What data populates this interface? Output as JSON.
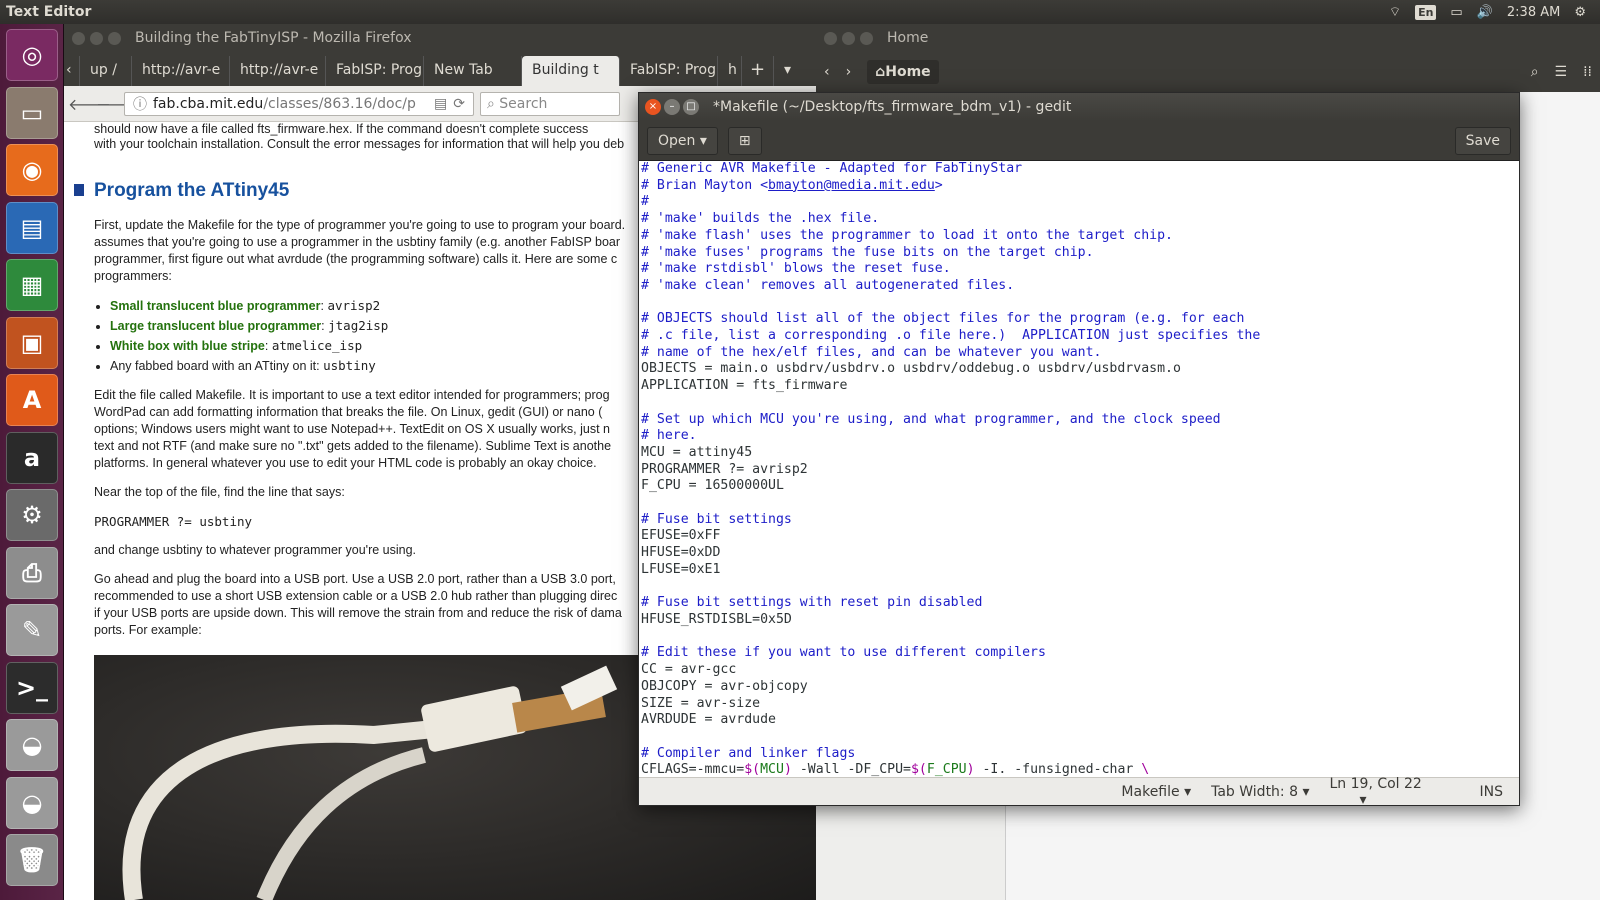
{
  "topbar": {
    "app": "Text Editor",
    "lang": "En",
    "time": "2:38 AM"
  },
  "launcher": [
    {
      "name": "ubuntu-dash-icon",
      "glyph": "◎",
      "color": "#7a2a62"
    },
    {
      "name": "files-icon",
      "glyph": "▭",
      "color": "#8a7b6e"
    },
    {
      "name": "firefox-icon",
      "glyph": "◉",
      "color": "#e76b1c"
    },
    {
      "name": "writer-icon",
      "glyph": "▤",
      "color": "#2a69b5"
    },
    {
      "name": "calc-icon",
      "glyph": "▦",
      "color": "#2e8a3c"
    },
    {
      "name": "impress-icon",
      "glyph": "▣",
      "color": "#c1531f"
    },
    {
      "name": "software-center-icon",
      "glyph": "A",
      "color": "#e05a1a"
    },
    {
      "name": "amazon-icon",
      "glyph": "a",
      "color": "#2a2a2a"
    },
    {
      "name": "system-settings-icon",
      "glyph": "⚙",
      "color": "#6a6a6a"
    },
    {
      "name": "printer-icon",
      "glyph": "⎙",
      "color": "#8d8d8d"
    },
    {
      "name": "text-editor-icon",
      "glyph": "✎",
      "color": "#9a9a9a"
    },
    {
      "name": "terminal-icon",
      "glyph": ">_",
      "color": "#2c2c2c"
    },
    {
      "name": "disk-icon",
      "glyph": "◒",
      "color": "#9a9a9a"
    },
    {
      "name": "disk2-icon",
      "glyph": "◒",
      "color": "#9a9a9a"
    },
    {
      "name": "trash-icon",
      "glyph": "🗑",
      "color": "#8a8a8a"
    }
  ],
  "firefox": {
    "title": "Building the FabTinyISP - Mozilla Firefox",
    "tabs": [
      "up /",
      "http://avr-e",
      "http://avr-e",
      "FabISP: Prog",
      "New Tab",
      "Building t",
      "FabISP: Prog",
      "h"
    ],
    "url_host": "fab.cba.mit.edu",
    "url_path": "/classes/863.16/doc/p",
    "search_placeholder": "Search",
    "top_line1": "should now have a file called fts_firmware.hex. If the command doesn't complete success",
    "top_line2": "with your toolchain installation. Consult the error messages for information that will help you deb",
    "heading": "Program the ATtiny45",
    "p1a": "First, update the Makefile for the type of programmer you're going to use to program your board.",
    "p1b": "assumes that you're going to use a programmer in the usbtiny family (e.g. another FabISP boar",
    "p1c": "programmer, first figure out what avrdude (the programming software) calls it. Here are some c",
    "p1d": "programmers:",
    "list": [
      {
        "label": "Small translucent blue programmer",
        "value": "avrisp2"
      },
      {
        "label": "Large translucent blue programmer",
        "value": "jtag2isp"
      },
      {
        "label": "White box with blue stripe",
        "value": "atmelice_isp"
      },
      {
        "label": "Any fabbed board with an ATtiny on it:",
        "value": "usbtiny"
      }
    ],
    "p2a": "Edit the file called Makefile. It is important to use a text editor intended for programmers; prog",
    "p2b": "WordPad can add formatting information that breaks the file. On Linux, gedit (GUI) or nano (",
    "p2c": "options; Windows users might want to use Notepad++. TextEdit on OS X usually works, just n",
    "p2d": "text and not RTF (and make sure no \".txt\" gets added to the filename). Sublime Text is anothe",
    "p2e": "platforms. In general whatever you use to edit your HTML code is probably an okay choice.",
    "p3": "Near the top of the file, find the line that says:",
    "code": "PROGRAMMER ?= usbtiny",
    "p4": "and change usbtiny to whatever programmer you're using.",
    "p5a": "Go ahead and plug the board into a USB port. Use a USB 2.0 port, rather than a USB 3.0 port,",
    "p5b": "recommended to use a short USB extension cable or a USB 2.0 hub rather than plugging direc",
    "p5c": "if your USB ports are upside down. This will remove the strain from and reduce the risk of dama",
    "p5d": "ports. For example:"
  },
  "files": {
    "title": "Home",
    "location": "Home"
  },
  "gedit": {
    "title": "*Makefile (~/Desktop/fts_firmware_bdm_v1) - gedit",
    "open_label": "Open",
    "save_label": "Save",
    "lines": [
      "# Generic AVR Makefile - Adapted for FabTinyStar",
      "# Brian Mayton <bmayton@media.mit.edu>",
      "#",
      "# 'make' builds the .hex file.",
      "# 'make flash' uses the programmer to load it onto the target chip.",
      "# 'make fuses' programs the fuse bits on the target chip.",
      "# 'make rstdisbl' blows the reset fuse.",
      "# 'make clean' removes all autogenerated files.",
      "",
      "# OBJECTS should list all of the object files for the program (e.g. for each",
      "# .c file, list a corresponding .o file here.)  APPLICATION just specifies the",
      "# name of the hex/elf files, and can be whatever you want.",
      "OBJECTS = main.o usbdrv/usbdrv.o usbdrv/oddebug.o usbdrv/usbdrvasm.o",
      "APPLICATION = fts_firmware",
      "",
      "# Set up which MCU you're using, and what programmer, and the clock speed",
      "# here.",
      "MCU = attiny45",
      "PROGRAMMER ?= avrisp2",
      "F_CPU = 16500000UL",
      "",
      "# Fuse bit settings",
      "EFUSE=0xFF",
      "HFUSE=0xDD",
      "LFUSE=0xE1",
      "",
      "# Fuse bit settings with reset pin disabled",
      "HFUSE_RSTDISBL=0x5D",
      "",
      "# Edit these if you want to use different compilers",
      "CC = avr-gcc",
      "OBJCOPY = avr-objcopy",
      "SIZE = avr-size",
      "AVRDUDE = avrdude",
      "",
      "# Compiler and linker flags",
      "CFLAGS=-mmcu=$(MCU) -Wall -DF_CPU=$(F_CPU) -I. -funsigned-char \\"
    ],
    "status": {
      "language": "Makefile",
      "tab_width": "Tab Width: 8",
      "position": "Ln 19, Col 22",
      "mode": "INS"
    }
  }
}
